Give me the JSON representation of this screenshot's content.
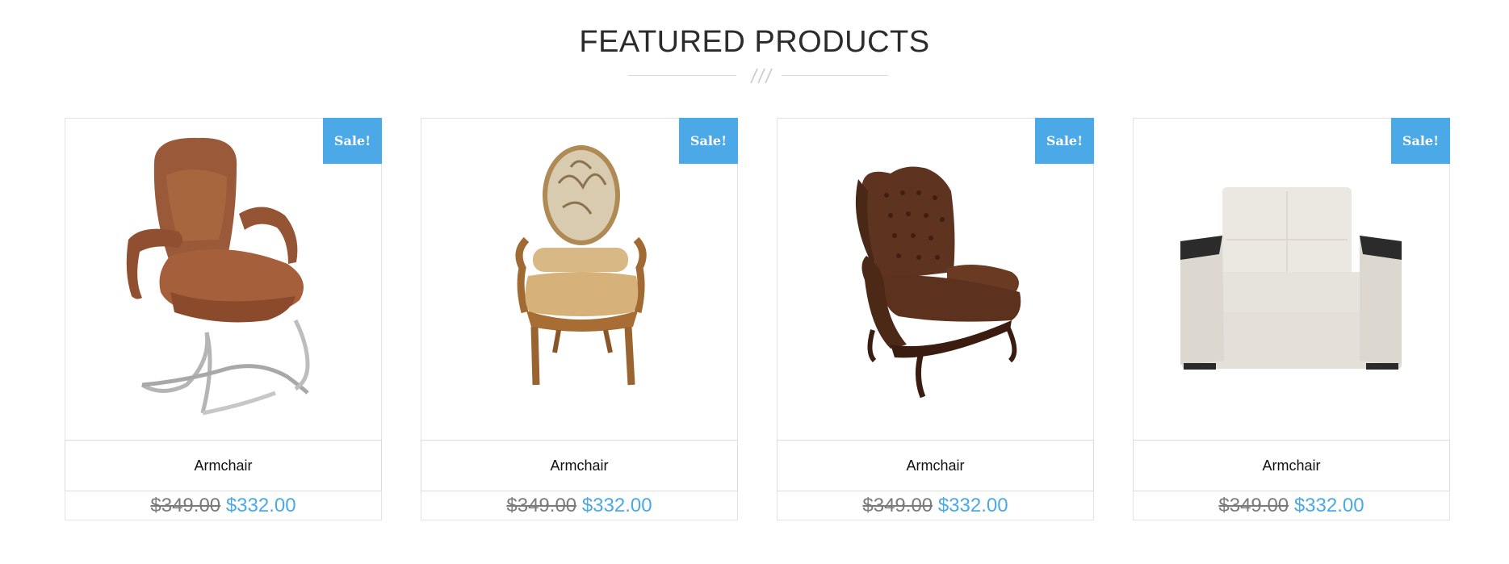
{
  "section": {
    "title": "FEATURED PRODUCTS"
  },
  "colors": {
    "accent": "#4aa9e6",
    "old_price": "#7a7a7a",
    "title": "#2b2b2b",
    "border": "#e3e3e3"
  },
  "products": [
    {
      "badge": "Sale!",
      "name": "Armchair",
      "old_price": "$349.00",
      "new_price": "$332.00",
      "image_icon": "brown-office-chair"
    },
    {
      "badge": "Sale!",
      "name": "Armchair",
      "old_price": "$349.00",
      "new_price": "$332.00",
      "image_icon": "ornate-wooden-chair"
    },
    {
      "badge": "Sale!",
      "name": "Armchair",
      "old_price": "$349.00",
      "new_price": "$332.00",
      "image_icon": "tufted-leather-wingback-chair"
    },
    {
      "badge": "Sale!",
      "name": "Armchair",
      "old_price": "$349.00",
      "new_price": "$332.00",
      "image_icon": "white-modern-armchair"
    }
  ]
}
